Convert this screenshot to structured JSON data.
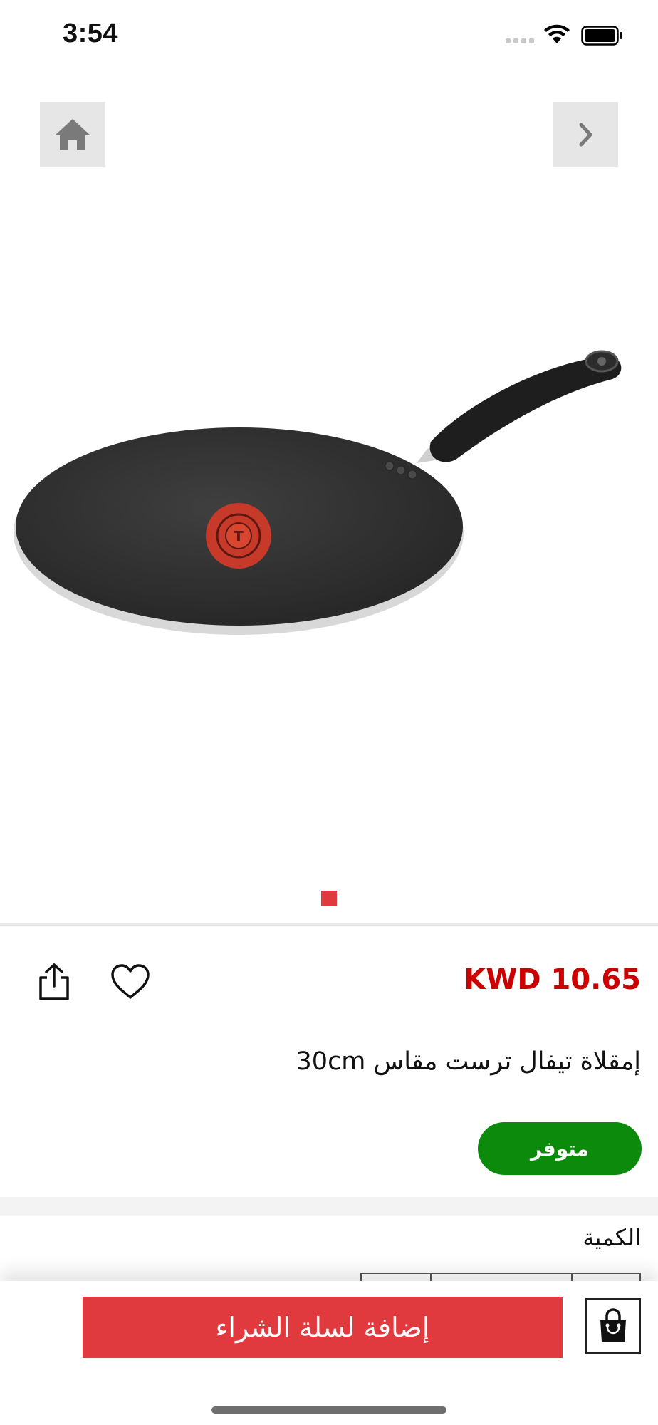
{
  "status_bar": {
    "time": "3:54"
  },
  "product": {
    "price": "KWD 10.65",
    "title": "إمقلاة تيفال ترست مقاس 30cm",
    "stock_status": "متوفر"
  },
  "quantity": {
    "label": "الكمية"
  },
  "actions": {
    "add_to_cart_label": "إضافة لسلة الشراء"
  },
  "icons": {
    "home": "home-icon",
    "next": "chevron-right-icon",
    "share": "share-icon",
    "favorite": "heart-icon",
    "cart": "shopping-bag-icon"
  },
  "colors": {
    "accent": "#e0393e",
    "price": "#cc0000",
    "in_stock": "#0b8a0b",
    "nav_button_bg": "#e6e6e6"
  },
  "gallery": {
    "current_index": 1,
    "total": 1
  }
}
